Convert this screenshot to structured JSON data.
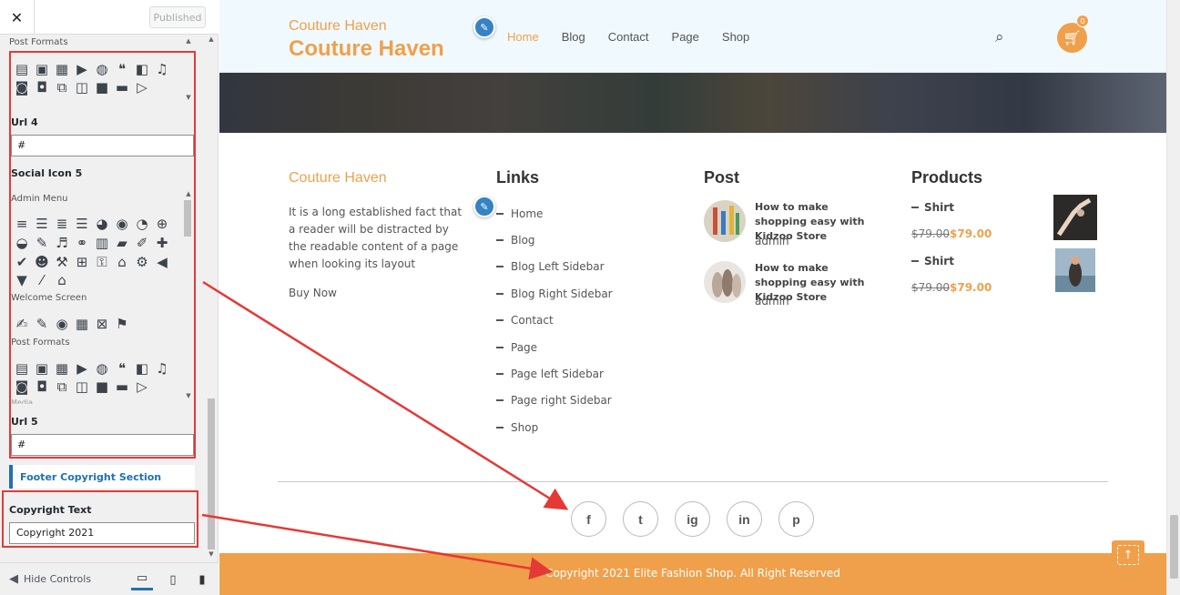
{
  "customizer": {
    "close_label": "✕",
    "published_label": "Published",
    "post_formats_label": "Post Formats",
    "url4": {
      "title": "Url 4",
      "value": "#"
    },
    "social_icon5_title": "Social Icon 5",
    "admin_menu_label": "Admin Menu",
    "welcome_screen_label": "Welcome Screen",
    "post_formats_label_2": "Post Formats",
    "media_label": "Media",
    "url5": {
      "title": "Url 5",
      "value": "#"
    },
    "footer_copyright_section": "Footer Copyright Section",
    "copyright_text": {
      "title": "Copyright Text",
      "value": "Copyright 2021"
    },
    "hide_controls": "Hide Controls"
  },
  "site": {
    "tagline": "Couture Haven",
    "title": "Couture Haven",
    "nav": [
      "Home",
      "Blog",
      "Contact",
      "Page",
      "Shop"
    ],
    "cart_count": "0"
  },
  "footer": {
    "about": {
      "title": "Couture Haven",
      "text": "It is a long established fact that a reader will be distracted by the readable content of a page when looking its layout",
      "link": "Buy Now"
    },
    "links": {
      "heading": "Links",
      "items": [
        "Home",
        "Blog",
        "Blog Left Sidebar",
        "Blog Right Sidebar",
        "Contact",
        "Page",
        "Page left Sidebar",
        "Page right Sidebar",
        "Shop"
      ]
    },
    "posts": {
      "heading": "Post",
      "items": [
        {
          "title": "How to make shopping easy with Kidzoo Store",
          "author": "admin"
        },
        {
          "title": "How to make shopping easy with Kidzoo Store",
          "author": "admin"
        }
      ]
    },
    "products": {
      "heading": "Products",
      "items": [
        {
          "name": "Shirt",
          "old_price": "$79.00",
          "price": "$79.00"
        },
        {
          "name": "Shirt",
          "old_price": "$79.00",
          "price": "$79.00"
        }
      ]
    },
    "socials": [
      "f",
      "t",
      "ig",
      "in",
      "p"
    ],
    "copyright": "Copyright 2021 Elite Fashion Shop. All Right Reserved"
  },
  "colors": {
    "accent": "#f0a04b",
    "wp_blue": "#2271b1",
    "annotation_red": "#e53935"
  }
}
